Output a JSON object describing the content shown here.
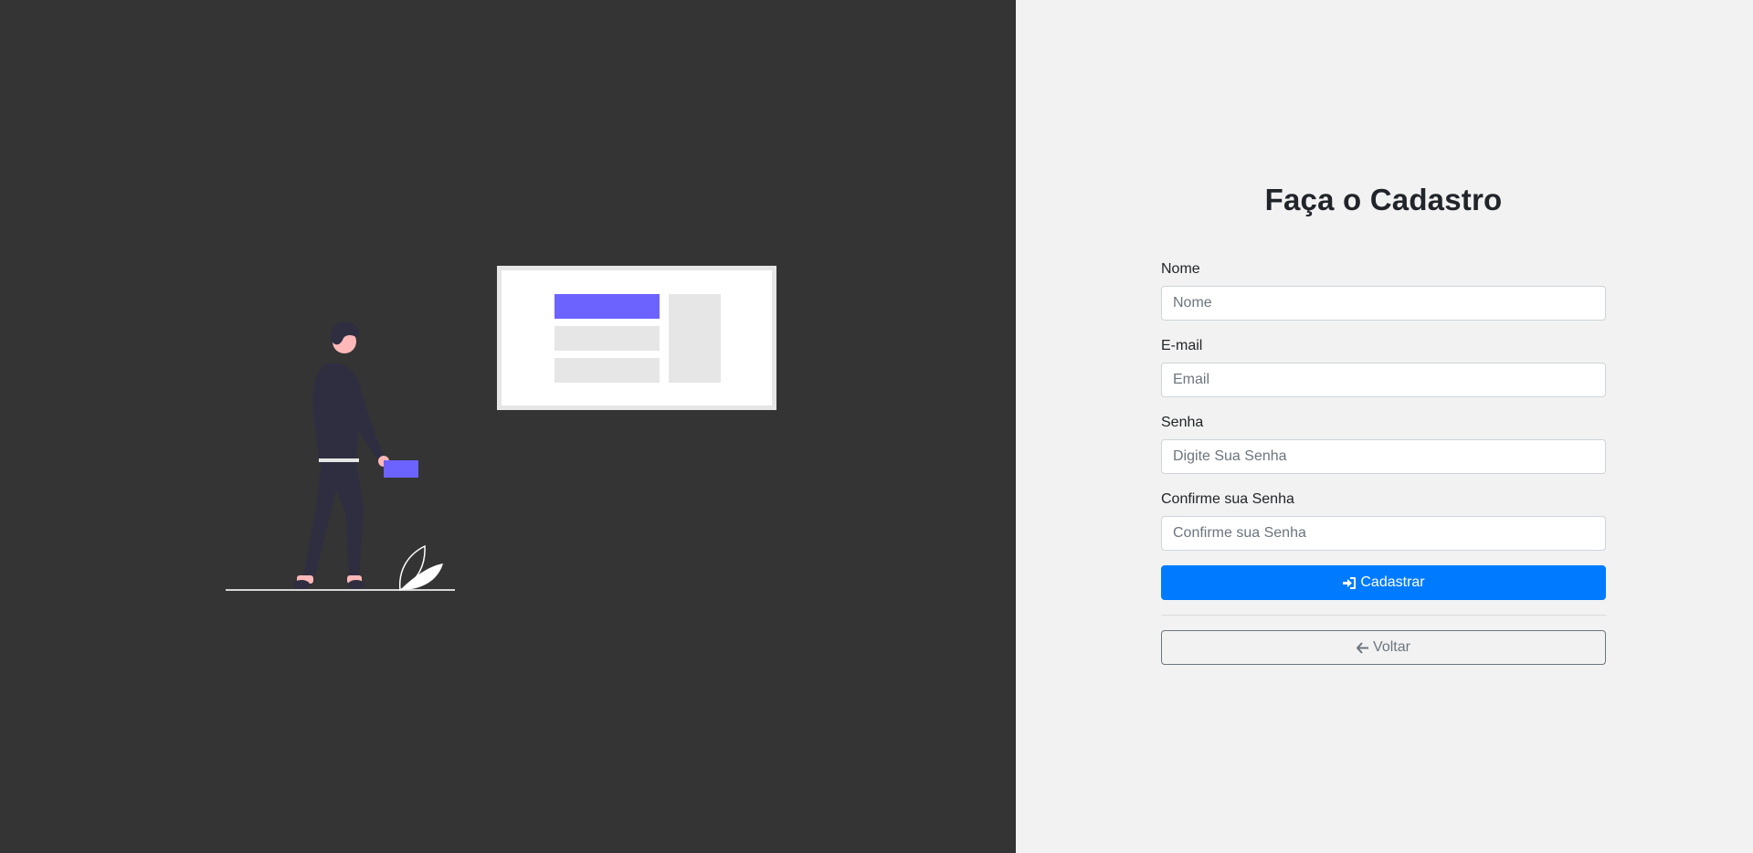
{
  "illustration": {
    "icon": "person-with-board-illustration",
    "colors": {
      "accent": "#6c63ff",
      "figure": "#2f2e41",
      "skin": "#ffb8b8",
      "board": "#ffffff",
      "board_frame": "#e6e6e6"
    }
  },
  "form": {
    "title": "Faça o Cadastro",
    "fields": [
      {
        "label": "Nome",
        "placeholder": "Nome",
        "value": ""
      },
      {
        "label": "E-mail",
        "placeholder": "Email",
        "value": ""
      },
      {
        "label": "Senha",
        "placeholder": "Digite Sua Senha",
        "value": ""
      },
      {
        "label": "Confirme sua Senha",
        "placeholder": "Confirme sua Senha",
        "value": ""
      }
    ],
    "submit": {
      "label": "Cadastrar",
      "icon": "sign-in-icon"
    },
    "back": {
      "label": "Voltar",
      "icon": "arrow-left-icon"
    }
  },
  "colors": {
    "left_bg": "#343434",
    "right_bg": "#f2f2f2",
    "primary": "#007bff",
    "secondary": "#6c757d"
  }
}
